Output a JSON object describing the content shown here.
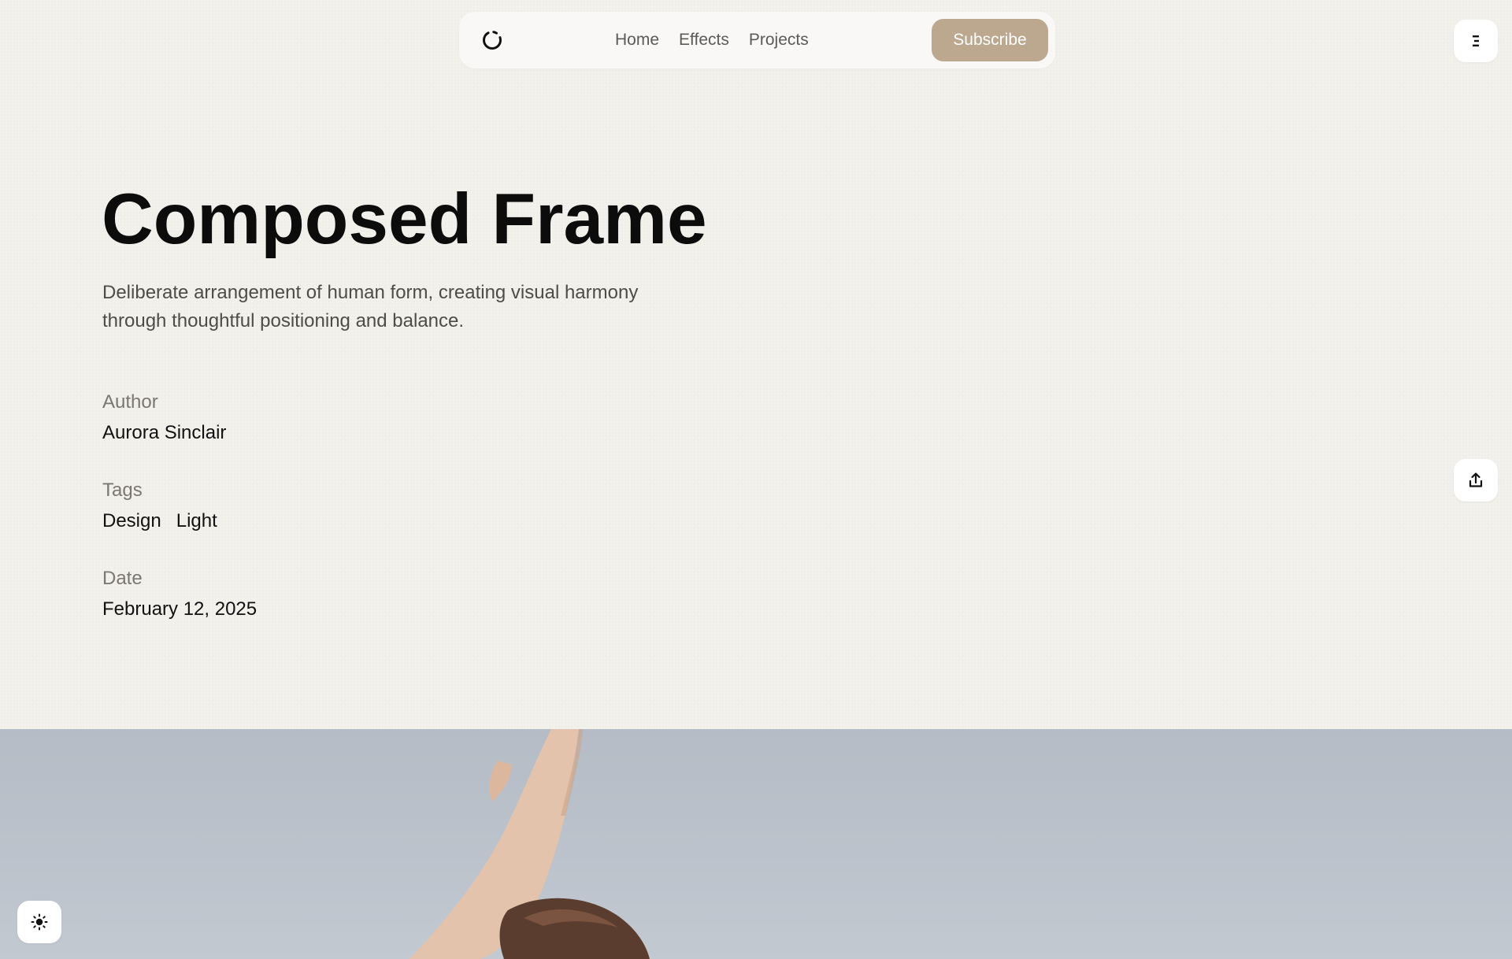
{
  "nav": {
    "logo_icon": "loading-circle-icon",
    "links": [
      {
        "label": "Home"
      },
      {
        "label": "Effects"
      },
      {
        "label": "Projects"
      }
    ],
    "subscribe_label": "Subscribe",
    "accent_color": "#bba88f"
  },
  "floating": {
    "menu_icon": "menu-icon",
    "share_icon": "share-icon",
    "theme_icon": "sun-icon"
  },
  "article": {
    "title": "Composed Frame",
    "description": "Deliberate arrangement of human form, creating visual harmony through thoughtful positioning and balance.",
    "author_label": "Author",
    "author": "Aurora Sinclair",
    "tags_label": "Tags",
    "tags": [
      "Design",
      "Light"
    ],
    "date_label": "Date",
    "date": "February 12, 2025"
  }
}
